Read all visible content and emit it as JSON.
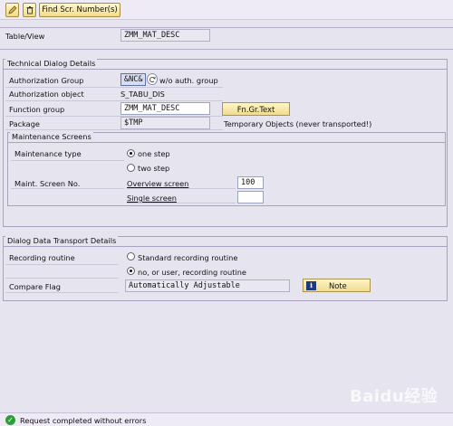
{
  "toolbar": {
    "edit_icon": "pencil-icon",
    "delete_icon": "trash-icon",
    "find_button": "Find Scr. Number(s)"
  },
  "header": {
    "table_view_label": "Table/View",
    "table_view_value": "ZMM_MAT_DESC"
  },
  "technical": {
    "title": "Technical Dialog Details",
    "auth_group_label": "Authorization Group",
    "auth_group_value": "&NC&",
    "auth_group_hint": "w/o auth. group",
    "auth_object_label": "Authorization object",
    "auth_object_value": "S_TABU_DIS",
    "function_group_label": "Function group",
    "function_group_value": "ZMM_MAT_DESC",
    "fn_gr_text_button": "Fn.Gr.Text",
    "package_label": "Package",
    "package_value": "$TMP",
    "package_desc": "Temporary Objects (never transported!)"
  },
  "maintenance": {
    "title": "Maintenance Screens",
    "type_label": "Maintenance type",
    "one_step": "one step",
    "two_step": "two step",
    "screen_no_label": "Maint. Screen No.",
    "overview_label": "Overview screen",
    "overview_value": "100",
    "single_label": "Single screen",
    "single_value": "",
    "selected_type": "one step"
  },
  "transport": {
    "title": "Dialog Data Transport Details",
    "recording_label": "Recording routine",
    "standard_option": "Standard recording routine",
    "no_option": "no, or user, recording routine",
    "compare_label": "Compare Flag",
    "compare_value": "Automatically Adjustable",
    "note_button": "Note",
    "selected_option": "no, or user, recording routine"
  },
  "status": {
    "message": "Request completed without errors",
    "icon": "check-icon"
  },
  "watermark": {
    "text": "Baidu经验"
  }
}
